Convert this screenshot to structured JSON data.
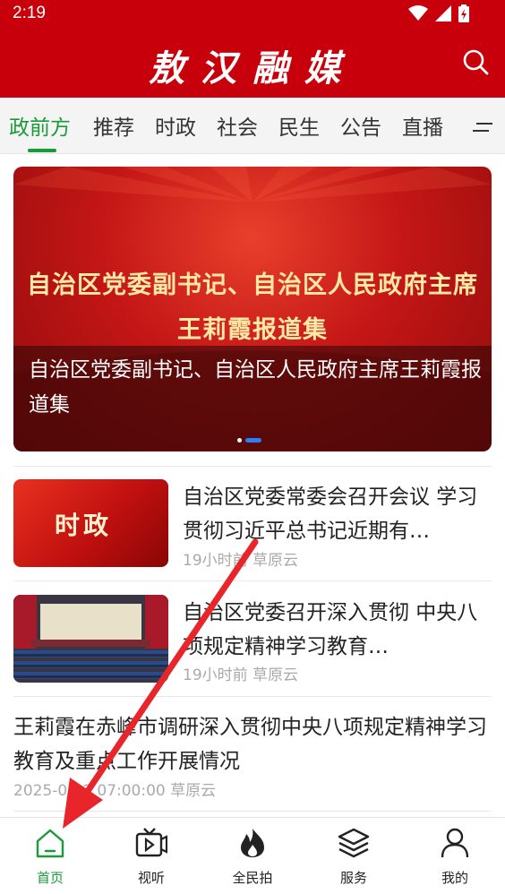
{
  "status_bar": {
    "time": "2:19"
  },
  "header": {
    "title": "敖汉融媒"
  },
  "tabs": [
    {
      "label": "政前方",
      "active": true
    },
    {
      "label": "推荐"
    },
    {
      "label": "时政"
    },
    {
      "label": "社会"
    },
    {
      "label": "民生"
    },
    {
      "label": "公告"
    },
    {
      "label": "直播"
    }
  ],
  "banner": {
    "headline_line1": "自治区党委副书记、自治区人民政府主席",
    "headline_line2": "王莉霞报道集",
    "caption": "自治区党委副书记、自治区人民政府主席王莉霞报道集",
    "pager_total": 2,
    "pager_active": 2
  },
  "news": [
    {
      "thumb_label": "时政",
      "title": "自治区党委常委会召开会议 学习贯彻习近平总书记近期有…",
      "meta": "19小时前 草原云"
    },
    {
      "title": "自治区党委召开深入贯彻 中央八项规定精神学习教育…",
      "meta": "19小时前 草原云"
    },
    {
      "title": "王莉霞在赤峰市调研深入贯彻中央八项规定精神学习教育及重点工作开展情况",
      "meta": "2025-05-2  07:00:00 草原云"
    }
  ],
  "bottom_nav": [
    {
      "label": "首页",
      "icon": "home-icon",
      "active": true
    },
    {
      "label": "视听",
      "icon": "tv-play-icon"
    },
    {
      "label": "全民拍",
      "icon": "fire-icon"
    },
    {
      "label": "服务",
      "icon": "layers-icon"
    },
    {
      "label": "我的",
      "icon": "user-icon"
    }
  ],
  "colors": {
    "brand_red": "#c8000b",
    "accent_green": "#1a9b3a",
    "pager_blue": "#2e7cf6",
    "annotation_arrow": "#e8252b"
  }
}
